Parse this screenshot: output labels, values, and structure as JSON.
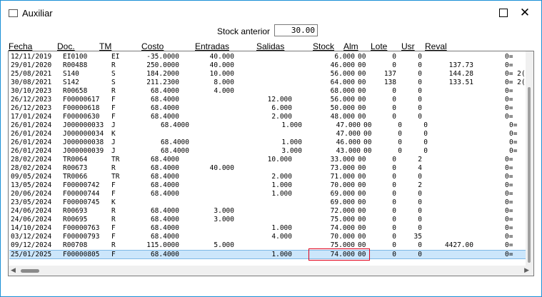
{
  "window": {
    "title": "Auxiliar",
    "minimize_icon": "maximize-icon",
    "close_icon": "close-icon"
  },
  "stock_anterior": {
    "label": "Stock anterior",
    "value": "30.00"
  },
  "columns": {
    "fecha": "Fecha",
    "doc": "Doc.",
    "tm": "TM",
    "costo": "Costo",
    "entradas": "Entradas",
    "salidas": "Salidas",
    "stock": "Stock",
    "alm": "Alm",
    "lote": "Lote",
    "usr": "Usr",
    "reval": "Reval"
  },
  "rows": [
    {
      "fecha": "12/11/2019",
      "doc": "EI0100",
      "tm": "EI",
      "costo": "-35.0000",
      "entradas": "40.000",
      "salidas": "",
      "stock": "6.000",
      "alm": "00",
      "lote": "0",
      "usr": "0",
      "reval": "",
      "flag": "0="
    },
    {
      "fecha": "29/01/2020",
      "doc": "R00488",
      "tm": "R",
      "costo": "250.0000",
      "entradas": "40.000",
      "salidas": "",
      "stock": "46.000",
      "alm": "00",
      "lote": "0",
      "usr": "0",
      "reval": "137.73",
      "flag": "0="
    },
    {
      "fecha": "25/08/2021",
      "doc": "S140",
      "tm": "S",
      "costo": "184.2000",
      "entradas": "10.000",
      "salidas": "",
      "stock": "56.000",
      "alm": "00",
      "lote": "137",
      "usr": "0",
      "reval": "144.28",
      "flag": "0= 2("
    },
    {
      "fecha": "30/08/2021",
      "doc": "S142",
      "tm": "S",
      "costo": "211.2300",
      "entradas": "8.000",
      "salidas": "",
      "stock": "64.000",
      "alm": "00",
      "lote": "138",
      "usr": "0",
      "reval": "133.51",
      "flag": "0= 2("
    },
    {
      "fecha": "30/10/2023",
      "doc": "R00658",
      "tm": "R",
      "costo": "68.4000",
      "entradas": "4.000",
      "salidas": "",
      "stock": "68.000",
      "alm": "00",
      "lote": "0",
      "usr": "0",
      "reval": "",
      "flag": "0="
    },
    {
      "fecha": "26/12/2023",
      "doc": "F00000617",
      "tm": "F",
      "costo": "68.4000",
      "entradas": "",
      "salidas": "12.000",
      "stock": "56.000",
      "alm": "00",
      "lote": "0",
      "usr": "0",
      "reval": "",
      "flag": "0="
    },
    {
      "fecha": "26/12/2023",
      "doc": "F00000618",
      "tm": "F",
      "costo": "68.4000",
      "entradas": "",
      "salidas": "6.000",
      "stock": "50.000",
      "alm": "00",
      "lote": "0",
      "usr": "0",
      "reval": "",
      "flag": "0="
    },
    {
      "fecha": "17/01/2024",
      "doc": "F00000630",
      "tm": "F",
      "costo": "68.4000",
      "entradas": "",
      "salidas": "2.000",
      "stock": "48.000",
      "alm": "00",
      "lote": "0",
      "usr": "0",
      "reval": "",
      "flag": "0="
    },
    {
      "fecha": "26/01/2024",
      "doc": "J000000033",
      "tm": "J",
      "costo": "68.4000",
      "entradas": "",
      "salidas": "1.000",
      "stock": "47.000",
      "alm": "00",
      "lote": "0",
      "usr": "0",
      "reval": "",
      "flag": "0=",
      "shift": true
    },
    {
      "fecha": "26/01/2024",
      "doc": "J000000034",
      "tm": "K",
      "costo": "",
      "entradas": "",
      "salidas": "",
      "stock": "47.000",
      "alm": "00",
      "lote": "0",
      "usr": "0",
      "reval": "",
      "flag": "0=",
      "shift": true
    },
    {
      "fecha": "26/01/2024",
      "doc": "J000000038",
      "tm": "J",
      "costo": "68.4000",
      "entradas": "",
      "salidas": "1.000",
      "stock": "46.000",
      "alm": "00",
      "lote": "0",
      "usr": "0",
      "reval": "",
      "flag": "0=",
      "shift": true
    },
    {
      "fecha": "26/01/2024",
      "doc": "J000000039",
      "tm": "J",
      "costo": "68.4000",
      "entradas": "",
      "salidas": "3.000",
      "stock": "43.000",
      "alm": "00",
      "lote": "0",
      "usr": "0",
      "reval": "",
      "flag": "0=",
      "shift": true
    },
    {
      "fecha": "28/02/2024",
      "doc": "TR0064",
      "tm": "TR",
      "costo": "68.4000",
      "entradas": "",
      "salidas": "10.000",
      "stock": "33.000",
      "alm": "00",
      "lote": "0",
      "usr": "2",
      "reval": "",
      "flag": "0="
    },
    {
      "fecha": "28/02/2024",
      "doc": "R00673",
      "tm": "R",
      "costo": "68.4000",
      "entradas": "40.000",
      "salidas": "",
      "stock": "73.000",
      "alm": "00",
      "lote": "0",
      "usr": "4",
      "reval": "",
      "flag": "0="
    },
    {
      "fecha": "09/05/2024",
      "doc": "TR0066",
      "tm": "TR",
      "costo": "68.4000",
      "entradas": "",
      "salidas": "2.000",
      "stock": "71.000",
      "alm": "00",
      "lote": "0",
      "usr": "0",
      "reval": "",
      "flag": "0="
    },
    {
      "fecha": "13/05/2024",
      "doc": "F00000742",
      "tm": "F",
      "costo": "68.4000",
      "entradas": "",
      "salidas": "1.000",
      "stock": "70.000",
      "alm": "00",
      "lote": "0",
      "usr": "2",
      "reval": "",
      "flag": "0="
    },
    {
      "fecha": "20/06/2024",
      "doc": "F00000744",
      "tm": "F",
      "costo": "68.4000",
      "entradas": "",
      "salidas": "1.000",
      "stock": "69.000",
      "alm": "00",
      "lote": "0",
      "usr": "0",
      "reval": "",
      "flag": "0="
    },
    {
      "fecha": "23/05/2024",
      "doc": "F00000745",
      "tm": "K",
      "costo": "",
      "entradas": "",
      "salidas": "",
      "stock": "69.000",
      "alm": "00",
      "lote": "0",
      "usr": "0",
      "reval": "",
      "flag": "0="
    },
    {
      "fecha": "24/06/2024",
      "doc": "R00693",
      "tm": "R",
      "costo": "68.4000",
      "entradas": "3.000",
      "salidas": "",
      "stock": "72.000",
      "alm": "00",
      "lote": "0",
      "usr": "0",
      "reval": "",
      "flag": "0="
    },
    {
      "fecha": "24/06/2024",
      "doc": "R00695",
      "tm": "R",
      "costo": "68.4000",
      "entradas": "3.000",
      "salidas": "",
      "stock": "75.000",
      "alm": "00",
      "lote": "0",
      "usr": "0",
      "reval": "",
      "flag": "0="
    },
    {
      "fecha": "14/10/2024",
      "doc": "F00000763",
      "tm": "F",
      "costo": "68.4000",
      "entradas": "",
      "salidas": "1.000",
      "stock": "74.000",
      "alm": "00",
      "lote": "0",
      "usr": "0",
      "reval": "",
      "flag": "0="
    },
    {
      "fecha": "03/12/2024",
      "doc": "F00000793",
      "tm": "F",
      "costo": "68.4000",
      "entradas": "",
      "salidas": "4.000",
      "stock": "70.000",
      "alm": "00",
      "lote": "0",
      "usr": "35",
      "reval": "",
      "flag": "0="
    },
    {
      "fecha": "09/12/2024",
      "doc": "R00708",
      "tm": "R",
      "costo": "115.0000",
      "entradas": "5.000",
      "salidas": "",
      "stock": "75.000",
      "alm": "00",
      "lote": "0",
      "usr": "0",
      "reval": "4427.00",
      "flag": "0="
    },
    {
      "fecha": "25/01/2025",
      "doc": "F00000805",
      "tm": "F",
      "costo": "68.4000",
      "entradas": "",
      "salidas": "1.000",
      "stock": "74.000",
      "alm": "00",
      "lote": "0",
      "usr": "0",
      "reval": "",
      "flag": "0=",
      "selected": true
    }
  ],
  "scroll": {
    "left_arrow_icon": "scroll-left-icon",
    "right_arrow_icon": "scroll-right-icon"
  },
  "colors": {
    "selection": "#cce6fb",
    "highlight_border": "#e0001b",
    "window_border": "#1a8fd6"
  }
}
